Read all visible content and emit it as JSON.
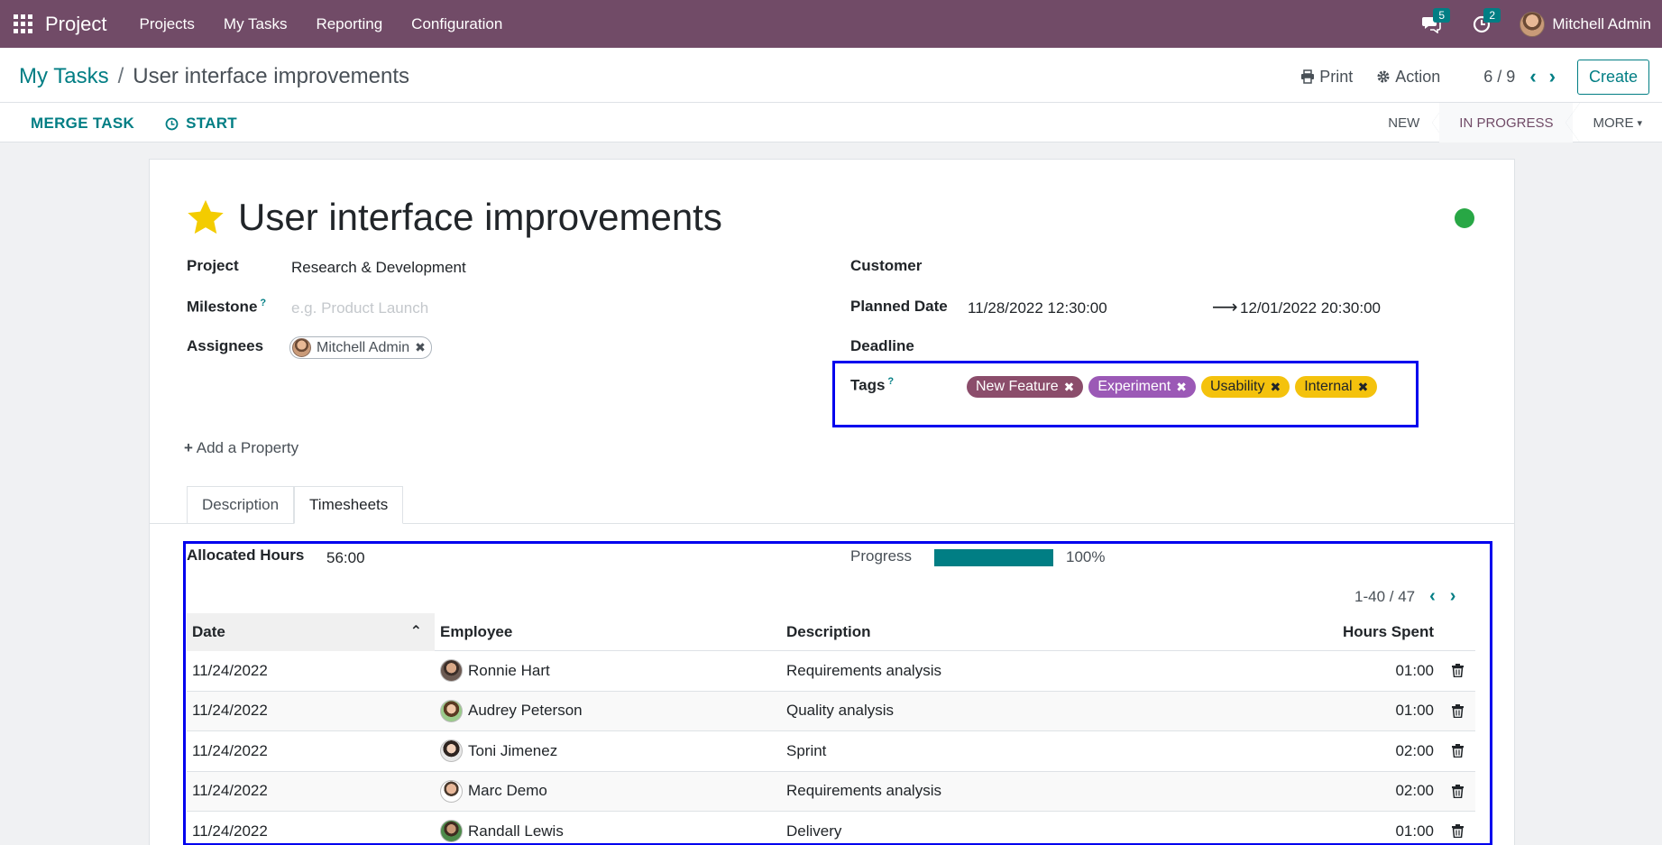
{
  "navbar": {
    "app_name": "Project",
    "menus": [
      "Projects",
      "My Tasks",
      "Reporting",
      "Configuration"
    ],
    "messages_count": "5",
    "activities_count": "2",
    "user_name": "Mitchell Admin"
  },
  "control": {
    "breadcrumb_parent": "My Tasks",
    "breadcrumb_sep": "/",
    "breadcrumb_current": "User interface improvements",
    "print_label": "Print",
    "action_label": "Action",
    "pager": "6 / 9",
    "create_label": "Create",
    "merge_label": "MERGE TASK",
    "start_label": "START",
    "stages": [
      "NEW",
      "IN PROGRESS",
      "MORE"
    ]
  },
  "task": {
    "title": "User interface improvements",
    "project_label": "Project",
    "project_value": "Research & Development",
    "milestone_label": "Milestone",
    "milestone_help": "?",
    "milestone_placeholder": "e.g. Product Launch",
    "assignees_label": "Assignees",
    "assignee": "Mitchell Admin",
    "customer_label": "Customer",
    "planned_label": "Planned Date",
    "planned_start": "11/28/2022 12:30:00",
    "planned_end": "12/01/2022 20:30:00",
    "deadline_label": "Deadline",
    "tags_label": "Tags",
    "tags_help": "?",
    "tags": [
      {
        "name": "New Feature",
        "bg": "#8b4d6b",
        "fg": "#ffffff"
      },
      {
        "name": "Experiment",
        "bg": "#9b59b6",
        "fg": "#ffffff"
      },
      {
        "name": "Usability",
        "bg": "#f4c20d",
        "fg": "#212529"
      },
      {
        "name": "Internal",
        "bg": "#f4c20d",
        "fg": "#212529"
      }
    ],
    "add_property": "Add a Property"
  },
  "tabs": [
    "Description",
    "Timesheets"
  ],
  "timesheets": {
    "allocated_label": "Allocated Hours",
    "allocated_value": "56:00",
    "progress_label": "Progress",
    "progress_value": "100%",
    "progress_fraction": 1.0,
    "pager": "1-40 / 47",
    "columns": [
      "Date",
      "Employee",
      "Description",
      "Hours Spent"
    ],
    "rows": [
      {
        "date": "11/24/2022",
        "employee": "Ronnie Hart",
        "description": "Requirements analysis",
        "hours": "01:00"
      },
      {
        "date": "11/24/2022",
        "employee": "Audrey Peterson",
        "description": "Quality analysis",
        "hours": "01:00"
      },
      {
        "date": "11/24/2022",
        "employee": "Toni Jimenez",
        "description": "Sprint",
        "hours": "02:00"
      },
      {
        "date": "11/24/2022",
        "employee": "Marc Demo",
        "description": "Requirements analysis",
        "hours": "02:00"
      },
      {
        "date": "11/24/2022",
        "employee": "Randall Lewis",
        "description": "Delivery",
        "hours": "01:00"
      }
    ]
  },
  "colors": {
    "brand": "#714b67",
    "accent": "#017e84",
    "status_ok": "#28a745",
    "highlight_box": "#0000ee"
  }
}
